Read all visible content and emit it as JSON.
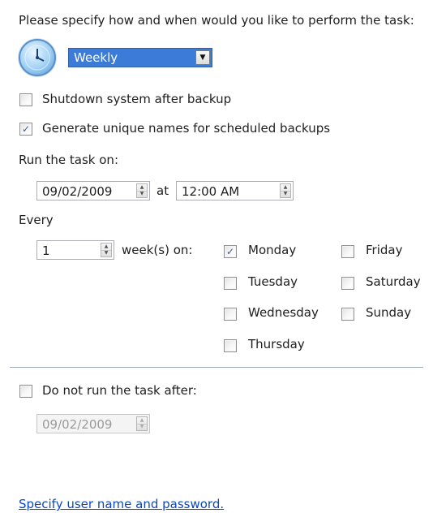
{
  "header": {
    "prompt": "Please specify how and when would you like to perform the task:"
  },
  "schedule": {
    "frequency": "Weekly",
    "icon": "clock-icon"
  },
  "options": {
    "shutdown": {
      "label": "Shutdown system after backup",
      "checked": false
    },
    "unique_names": {
      "label": "Generate unique names for scheduled backups",
      "checked": true
    }
  },
  "run": {
    "label": "Run the task on:",
    "date": "09/02/2009",
    "at_label": "at",
    "time": "12:00 AM"
  },
  "every": {
    "label": "Every",
    "value": "1",
    "unit_label": "week(s) on:"
  },
  "days": [
    {
      "label": "Monday",
      "checked": true
    },
    {
      "label": "Tuesday",
      "checked": false
    },
    {
      "label": "Wednesday",
      "checked": false
    },
    {
      "label": "Thursday",
      "checked": false
    },
    {
      "label": "Friday",
      "checked": false
    },
    {
      "label": "Saturday",
      "checked": false
    },
    {
      "label": "Sunday",
      "checked": false
    }
  ],
  "stop": {
    "label": "Do not run the task after:",
    "checked": false,
    "date": "09/02/2009"
  },
  "footer": {
    "link": "Specify user name and password."
  },
  "colors": {
    "selection": "#3d7bd9",
    "link": "#0b47c2",
    "check": "#3a5a9a"
  }
}
